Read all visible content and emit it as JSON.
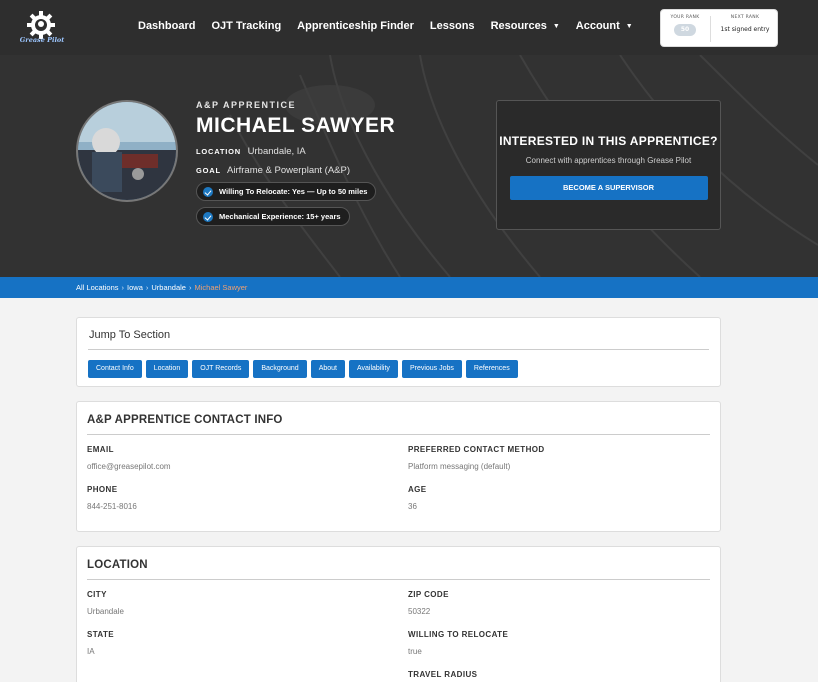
{
  "nav": {
    "logo_text": "Grease Pilot",
    "links": [
      "Dashboard",
      "OJT Tracking",
      "Apprenticeship Finder",
      "Lessons",
      "Resources",
      "Account"
    ],
    "rank": {
      "your_rank_label": "YOUR RANK",
      "your_rank_value": "50",
      "next_rank_label": "NEXT RANK",
      "next_rank_value": "1st signed entry"
    }
  },
  "hero": {
    "role": "A&P APPRENTICE",
    "name": "MICHAEL SAWYER",
    "location_label": "LOCATION",
    "location_value": "Urbandale, IA",
    "goal_label": "GOAL",
    "goal_value": "Airframe & Powerplant (A&P)",
    "badges": [
      "Willing To Relocate: Yes — Up to 50 miles",
      "Mechanical Experience: 15+ years"
    ]
  },
  "cta": {
    "title": "INTERESTED IN THIS APPRENTICE?",
    "subtitle": "Connect with apprentices through Grease Pilot",
    "button": "BECOME A SUPERVISOR"
  },
  "breadcrumb": {
    "items": [
      "All Locations",
      "Iowa",
      "Urbandale"
    ],
    "current": "Michael Sawyer",
    "separator": "›"
  },
  "jump": {
    "title": "Jump To Section",
    "buttons": [
      "Contact Info",
      "Location",
      "OJT Records",
      "Background",
      "About",
      "Availability",
      "Previous Jobs",
      "References"
    ]
  },
  "contact": {
    "title": "A&P APPRENTICE CONTACT INFO",
    "email_label": "EMAIL",
    "email_value": "office@greasepilot.com",
    "phone_label": "PHONE",
    "phone_value": "844-251-8016",
    "pref_label": "PREFERRED CONTACT METHOD",
    "pref_value": "Platform messaging (default)",
    "age_label": "AGE",
    "age_value": "36"
  },
  "location": {
    "title": "LOCATION",
    "city_label": "CITY",
    "city_value": "Urbandale",
    "state_label": "STATE",
    "state_value": "IA",
    "zip_label": "ZIP CODE",
    "zip_value": "50322",
    "relocate_label": "WILLING TO RELOCATE",
    "relocate_value": "true",
    "radius_label": "TRAVEL RADIUS"
  },
  "colors": {
    "accent": "#1672c4",
    "nav_bg": "#2e2e2e",
    "breadcrumb_current": "#f0a070"
  }
}
